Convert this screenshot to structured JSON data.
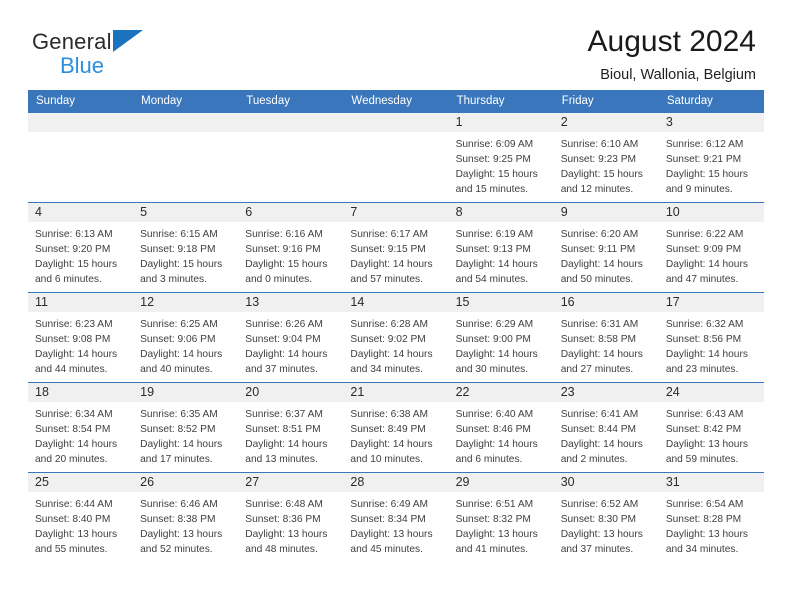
{
  "brand": {
    "name_part1": "General",
    "name_part2": "Blue",
    "triangle_color": "#1b72bd",
    "blue_text_color": "#2a8fe0"
  },
  "header": {
    "title": "August 2024",
    "subtitle": "Bioul, Wallonia, Belgium"
  },
  "theme": {
    "header_row_bg": "#3a76bb",
    "cell_top_border": "#3a76bb",
    "daynum_bg": "#f0f0f0"
  },
  "weekdays": [
    "Sunday",
    "Monday",
    "Tuesday",
    "Wednesday",
    "Thursday",
    "Friday",
    "Saturday"
  ],
  "labels": {
    "sunrise_prefix": "Sunrise:",
    "sunset_prefix": "Sunset:",
    "daylight_prefix": "Daylight:"
  },
  "weeks": [
    [
      {
        "day": "",
        "sunrise": "",
        "sunset": "",
        "daylight_line1": "",
        "daylight_line2": ""
      },
      {
        "day": "",
        "sunrise": "",
        "sunset": "",
        "daylight_line1": "",
        "daylight_line2": ""
      },
      {
        "day": "",
        "sunrise": "",
        "sunset": "",
        "daylight_line1": "",
        "daylight_line2": ""
      },
      {
        "day": "",
        "sunrise": "",
        "sunset": "",
        "daylight_line1": "",
        "daylight_line2": ""
      },
      {
        "day": "1",
        "sunrise": "Sunrise: 6:09 AM",
        "sunset": "Sunset: 9:25 PM",
        "daylight_line1": "Daylight: 15 hours",
        "daylight_line2": "and 15 minutes."
      },
      {
        "day": "2",
        "sunrise": "Sunrise: 6:10 AM",
        "sunset": "Sunset: 9:23 PM",
        "daylight_line1": "Daylight: 15 hours",
        "daylight_line2": "and 12 minutes."
      },
      {
        "day": "3",
        "sunrise": "Sunrise: 6:12 AM",
        "sunset": "Sunset: 9:21 PM",
        "daylight_line1": "Daylight: 15 hours",
        "daylight_line2": "and 9 minutes."
      }
    ],
    [
      {
        "day": "4",
        "sunrise": "Sunrise: 6:13 AM",
        "sunset": "Sunset: 9:20 PM",
        "daylight_line1": "Daylight: 15 hours",
        "daylight_line2": "and 6 minutes."
      },
      {
        "day": "5",
        "sunrise": "Sunrise: 6:15 AM",
        "sunset": "Sunset: 9:18 PM",
        "daylight_line1": "Daylight: 15 hours",
        "daylight_line2": "and 3 minutes."
      },
      {
        "day": "6",
        "sunrise": "Sunrise: 6:16 AM",
        "sunset": "Sunset: 9:16 PM",
        "daylight_line1": "Daylight: 15 hours",
        "daylight_line2": "and 0 minutes."
      },
      {
        "day": "7",
        "sunrise": "Sunrise: 6:17 AM",
        "sunset": "Sunset: 9:15 PM",
        "daylight_line1": "Daylight: 14 hours",
        "daylight_line2": "and 57 minutes."
      },
      {
        "day": "8",
        "sunrise": "Sunrise: 6:19 AM",
        "sunset": "Sunset: 9:13 PM",
        "daylight_line1": "Daylight: 14 hours",
        "daylight_line2": "and 54 minutes."
      },
      {
        "day": "9",
        "sunrise": "Sunrise: 6:20 AM",
        "sunset": "Sunset: 9:11 PM",
        "daylight_line1": "Daylight: 14 hours",
        "daylight_line2": "and 50 minutes."
      },
      {
        "day": "10",
        "sunrise": "Sunrise: 6:22 AM",
        "sunset": "Sunset: 9:09 PM",
        "daylight_line1": "Daylight: 14 hours",
        "daylight_line2": "and 47 minutes."
      }
    ],
    [
      {
        "day": "11",
        "sunrise": "Sunrise: 6:23 AM",
        "sunset": "Sunset: 9:08 PM",
        "daylight_line1": "Daylight: 14 hours",
        "daylight_line2": "and 44 minutes."
      },
      {
        "day": "12",
        "sunrise": "Sunrise: 6:25 AM",
        "sunset": "Sunset: 9:06 PM",
        "daylight_line1": "Daylight: 14 hours",
        "daylight_line2": "and 40 minutes."
      },
      {
        "day": "13",
        "sunrise": "Sunrise: 6:26 AM",
        "sunset": "Sunset: 9:04 PM",
        "daylight_line1": "Daylight: 14 hours",
        "daylight_line2": "and 37 minutes."
      },
      {
        "day": "14",
        "sunrise": "Sunrise: 6:28 AM",
        "sunset": "Sunset: 9:02 PM",
        "daylight_line1": "Daylight: 14 hours",
        "daylight_line2": "and 34 minutes."
      },
      {
        "day": "15",
        "sunrise": "Sunrise: 6:29 AM",
        "sunset": "Sunset: 9:00 PM",
        "daylight_line1": "Daylight: 14 hours",
        "daylight_line2": "and 30 minutes."
      },
      {
        "day": "16",
        "sunrise": "Sunrise: 6:31 AM",
        "sunset": "Sunset: 8:58 PM",
        "daylight_line1": "Daylight: 14 hours",
        "daylight_line2": "and 27 minutes."
      },
      {
        "day": "17",
        "sunrise": "Sunrise: 6:32 AM",
        "sunset": "Sunset: 8:56 PM",
        "daylight_line1": "Daylight: 14 hours",
        "daylight_line2": "and 23 minutes."
      }
    ],
    [
      {
        "day": "18",
        "sunrise": "Sunrise: 6:34 AM",
        "sunset": "Sunset: 8:54 PM",
        "daylight_line1": "Daylight: 14 hours",
        "daylight_line2": "and 20 minutes."
      },
      {
        "day": "19",
        "sunrise": "Sunrise: 6:35 AM",
        "sunset": "Sunset: 8:52 PM",
        "daylight_line1": "Daylight: 14 hours",
        "daylight_line2": "and 17 minutes."
      },
      {
        "day": "20",
        "sunrise": "Sunrise: 6:37 AM",
        "sunset": "Sunset: 8:51 PM",
        "daylight_line1": "Daylight: 14 hours",
        "daylight_line2": "and 13 minutes."
      },
      {
        "day": "21",
        "sunrise": "Sunrise: 6:38 AM",
        "sunset": "Sunset: 8:49 PM",
        "daylight_line1": "Daylight: 14 hours",
        "daylight_line2": "and 10 minutes."
      },
      {
        "day": "22",
        "sunrise": "Sunrise: 6:40 AM",
        "sunset": "Sunset: 8:46 PM",
        "daylight_line1": "Daylight: 14 hours",
        "daylight_line2": "and 6 minutes."
      },
      {
        "day": "23",
        "sunrise": "Sunrise: 6:41 AM",
        "sunset": "Sunset: 8:44 PM",
        "daylight_line1": "Daylight: 14 hours",
        "daylight_line2": "and 2 minutes."
      },
      {
        "day": "24",
        "sunrise": "Sunrise: 6:43 AM",
        "sunset": "Sunset: 8:42 PM",
        "daylight_line1": "Daylight: 13 hours",
        "daylight_line2": "and 59 minutes."
      }
    ],
    [
      {
        "day": "25",
        "sunrise": "Sunrise: 6:44 AM",
        "sunset": "Sunset: 8:40 PM",
        "daylight_line1": "Daylight: 13 hours",
        "daylight_line2": "and 55 minutes."
      },
      {
        "day": "26",
        "sunrise": "Sunrise: 6:46 AM",
        "sunset": "Sunset: 8:38 PM",
        "daylight_line1": "Daylight: 13 hours",
        "daylight_line2": "and 52 minutes."
      },
      {
        "day": "27",
        "sunrise": "Sunrise: 6:48 AM",
        "sunset": "Sunset: 8:36 PM",
        "daylight_line1": "Daylight: 13 hours",
        "daylight_line2": "and 48 minutes."
      },
      {
        "day": "28",
        "sunrise": "Sunrise: 6:49 AM",
        "sunset": "Sunset: 8:34 PM",
        "daylight_line1": "Daylight: 13 hours",
        "daylight_line2": "and 45 minutes."
      },
      {
        "day": "29",
        "sunrise": "Sunrise: 6:51 AM",
        "sunset": "Sunset: 8:32 PM",
        "daylight_line1": "Daylight: 13 hours",
        "daylight_line2": "and 41 minutes."
      },
      {
        "day": "30",
        "sunrise": "Sunrise: 6:52 AM",
        "sunset": "Sunset: 8:30 PM",
        "daylight_line1": "Daylight: 13 hours",
        "daylight_line2": "and 37 minutes."
      },
      {
        "day": "31",
        "sunrise": "Sunrise: 6:54 AM",
        "sunset": "Sunset: 8:28 PM",
        "daylight_line1": "Daylight: 13 hours",
        "daylight_line2": "and 34 minutes."
      }
    ]
  ]
}
